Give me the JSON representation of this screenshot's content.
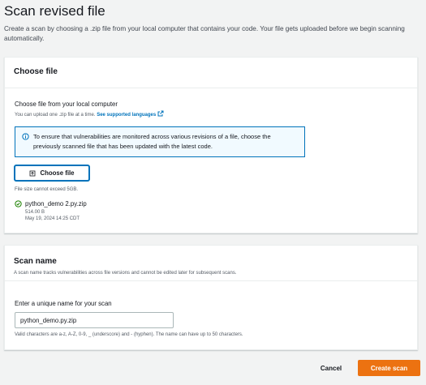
{
  "page": {
    "title": "Scan revised file",
    "description": "Create a scan by choosing a .zip file from your local computer that contains your code. Your file gets uploaded before we begin scanning automatically."
  },
  "choose_file_section": {
    "header": "Choose file",
    "field_label": "Choose file from your local computer",
    "hint_prefix": "You can upload one .zip file at a time.",
    "hint_link": "See supported languages",
    "info_text": "To ensure that vulnerabilities are monitored across various revisions of a file, choose the previously scanned file that has been updated with the latest code.",
    "button_label": "Choose file",
    "size_constraint": "File size cannot exceed 5GB.",
    "file": {
      "name": "python_demo 2.py.zip",
      "size": "514.00 B",
      "modified": "May 19, 2024 14:25 CDT"
    }
  },
  "scan_name_section": {
    "header": "Scan name",
    "description": "A scan name tracks vulnerabilities across file versions and cannot be edited later for subsequent scans.",
    "field_label": "Enter a unique name for your scan",
    "input_value": "python_demo.py.zip",
    "constraint": "Valid characters are a-z, A-Z, 0-9, _ (underscore) and - (hyphen). The name can have up to 50 characters."
  },
  "actions": {
    "cancel_label": "Cancel",
    "create_label": "Create scan"
  },
  "colors": {
    "primary": "#ec7211",
    "link": "#0073bb",
    "success": "#1d8102"
  }
}
